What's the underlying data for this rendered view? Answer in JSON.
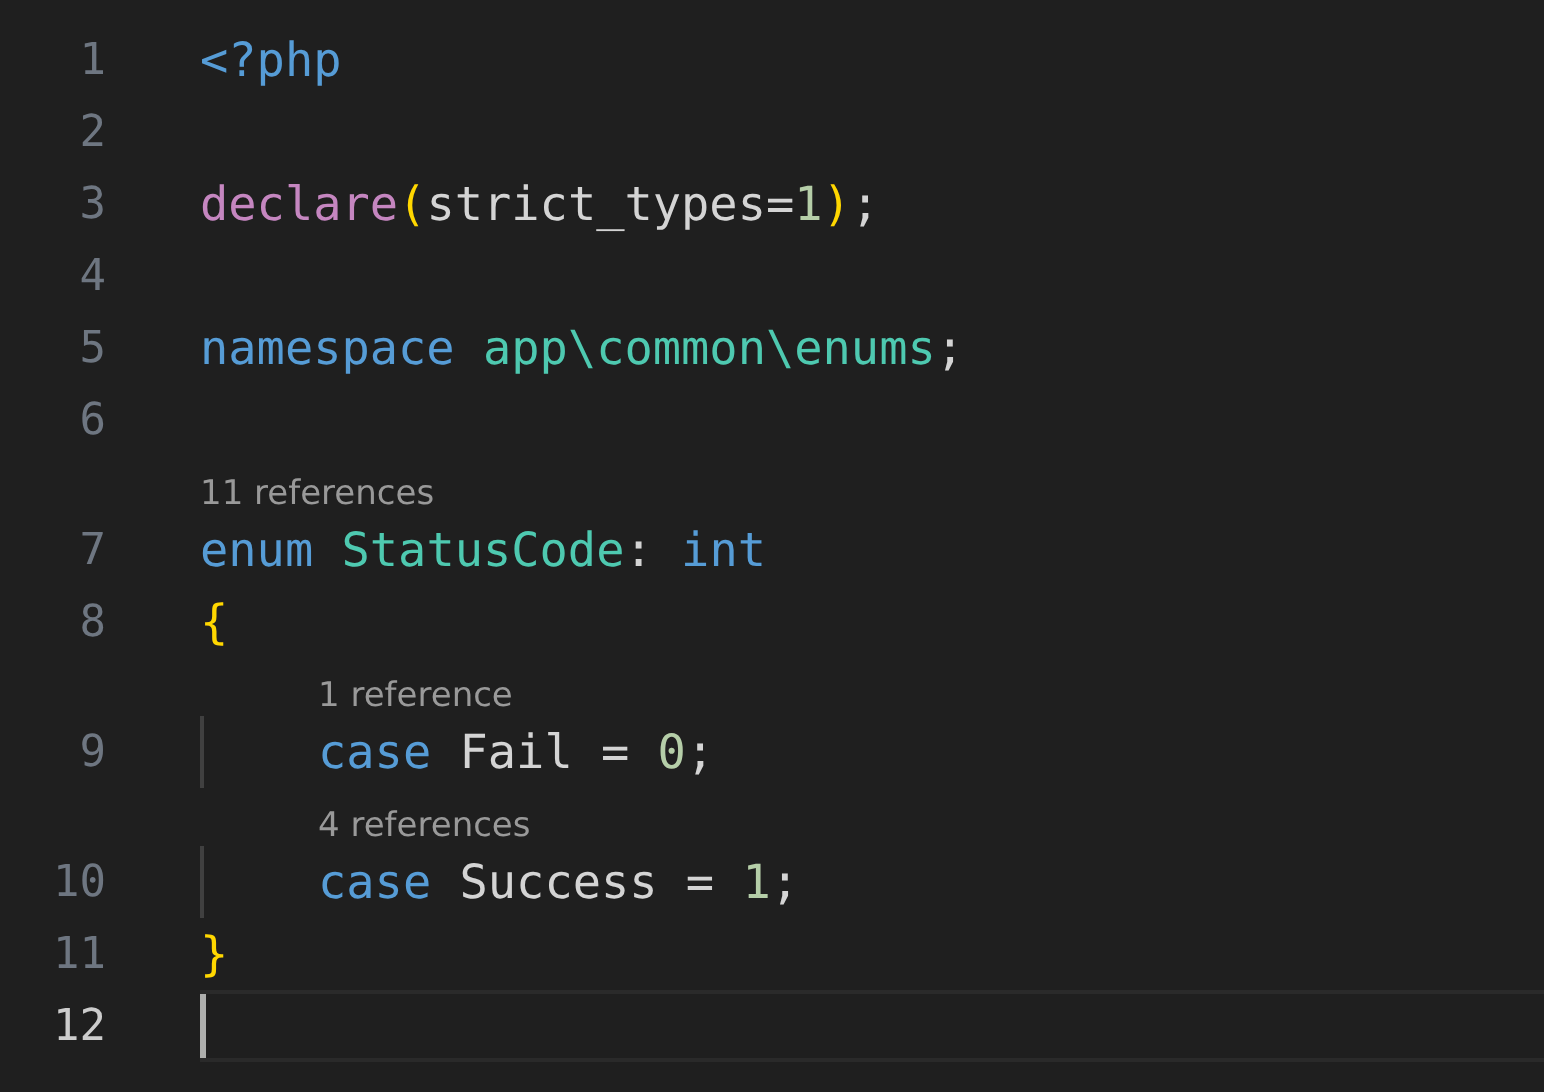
{
  "editor": {
    "lines": [
      {
        "number": "1",
        "selected": false,
        "indented": false,
        "tokens": [
          {
            "kind": "keyword",
            "text": "<?php"
          }
        ]
      },
      {
        "number": "2",
        "selected": false
      },
      {
        "number": "3",
        "selected": false,
        "indented": false,
        "tokens": [
          {
            "kind": "control",
            "text": "declare"
          },
          {
            "kind": "bracket",
            "text": "("
          },
          {
            "kind": "plain",
            "text": "strict_types="
          },
          {
            "kind": "number",
            "text": "1"
          },
          {
            "kind": "bracket",
            "text": ")"
          },
          {
            "kind": "plain",
            "text": ";"
          }
        ]
      },
      {
        "number": "4",
        "selected": false
      },
      {
        "number": "5",
        "selected": false,
        "indented": false,
        "tokens": [
          {
            "kind": "keyword",
            "text": "namespace"
          },
          {
            "kind": "type",
            "text": "app\\common\\enums"
          },
          {
            "kind": "plain",
            "text": ";"
          }
        ]
      },
      {
        "number": "6",
        "selected": false
      },
      {
        "number": "7",
        "selected": false,
        "indented": false,
        "codelens": "11 references",
        "tokens": [
          {
            "kind": "keyword",
            "text": "enum"
          },
          {
            "kind": "type",
            "text": "StatusCode"
          },
          {
            "kind": "plain",
            "text": ":"
          },
          {
            "kind": "keyword",
            "text": "int"
          }
        ]
      },
      {
        "number": "8",
        "selected": false,
        "indented": false,
        "tokens": [
          {
            "kind": "bracket",
            "text": "{"
          }
        ]
      },
      {
        "number": "9",
        "selected": false,
        "indented": true,
        "codelens": "1 reference",
        "tokens": [
          {
            "kind": "keyword",
            "text": "case"
          },
          {
            "kind": "plain",
            "text": "Fail = "
          },
          {
            "kind": "number",
            "text": "0"
          },
          {
            "kind": "plain",
            "text": ";"
          }
        ]
      },
      {
        "number": "10",
        "selected": false,
        "indented": true,
        "codelens": "4 references",
        "tokens": [
          {
            "kind": "keyword",
            "text": "case"
          },
          {
            "kind": "plain",
            "text": "Success = "
          },
          {
            "kind": "number",
            "text": "1"
          },
          {
            "kind": "plain",
            "text": ";"
          }
        ]
      },
      {
        "number": "11",
        "selected": false,
        "indented": false,
        "tokens": [
          {
            "kind": "bracket",
            "text": "}"
          }
        ]
      },
      {
        "number": "12",
        "selected": true,
        "indented": false
      }
    ]
  }
}
